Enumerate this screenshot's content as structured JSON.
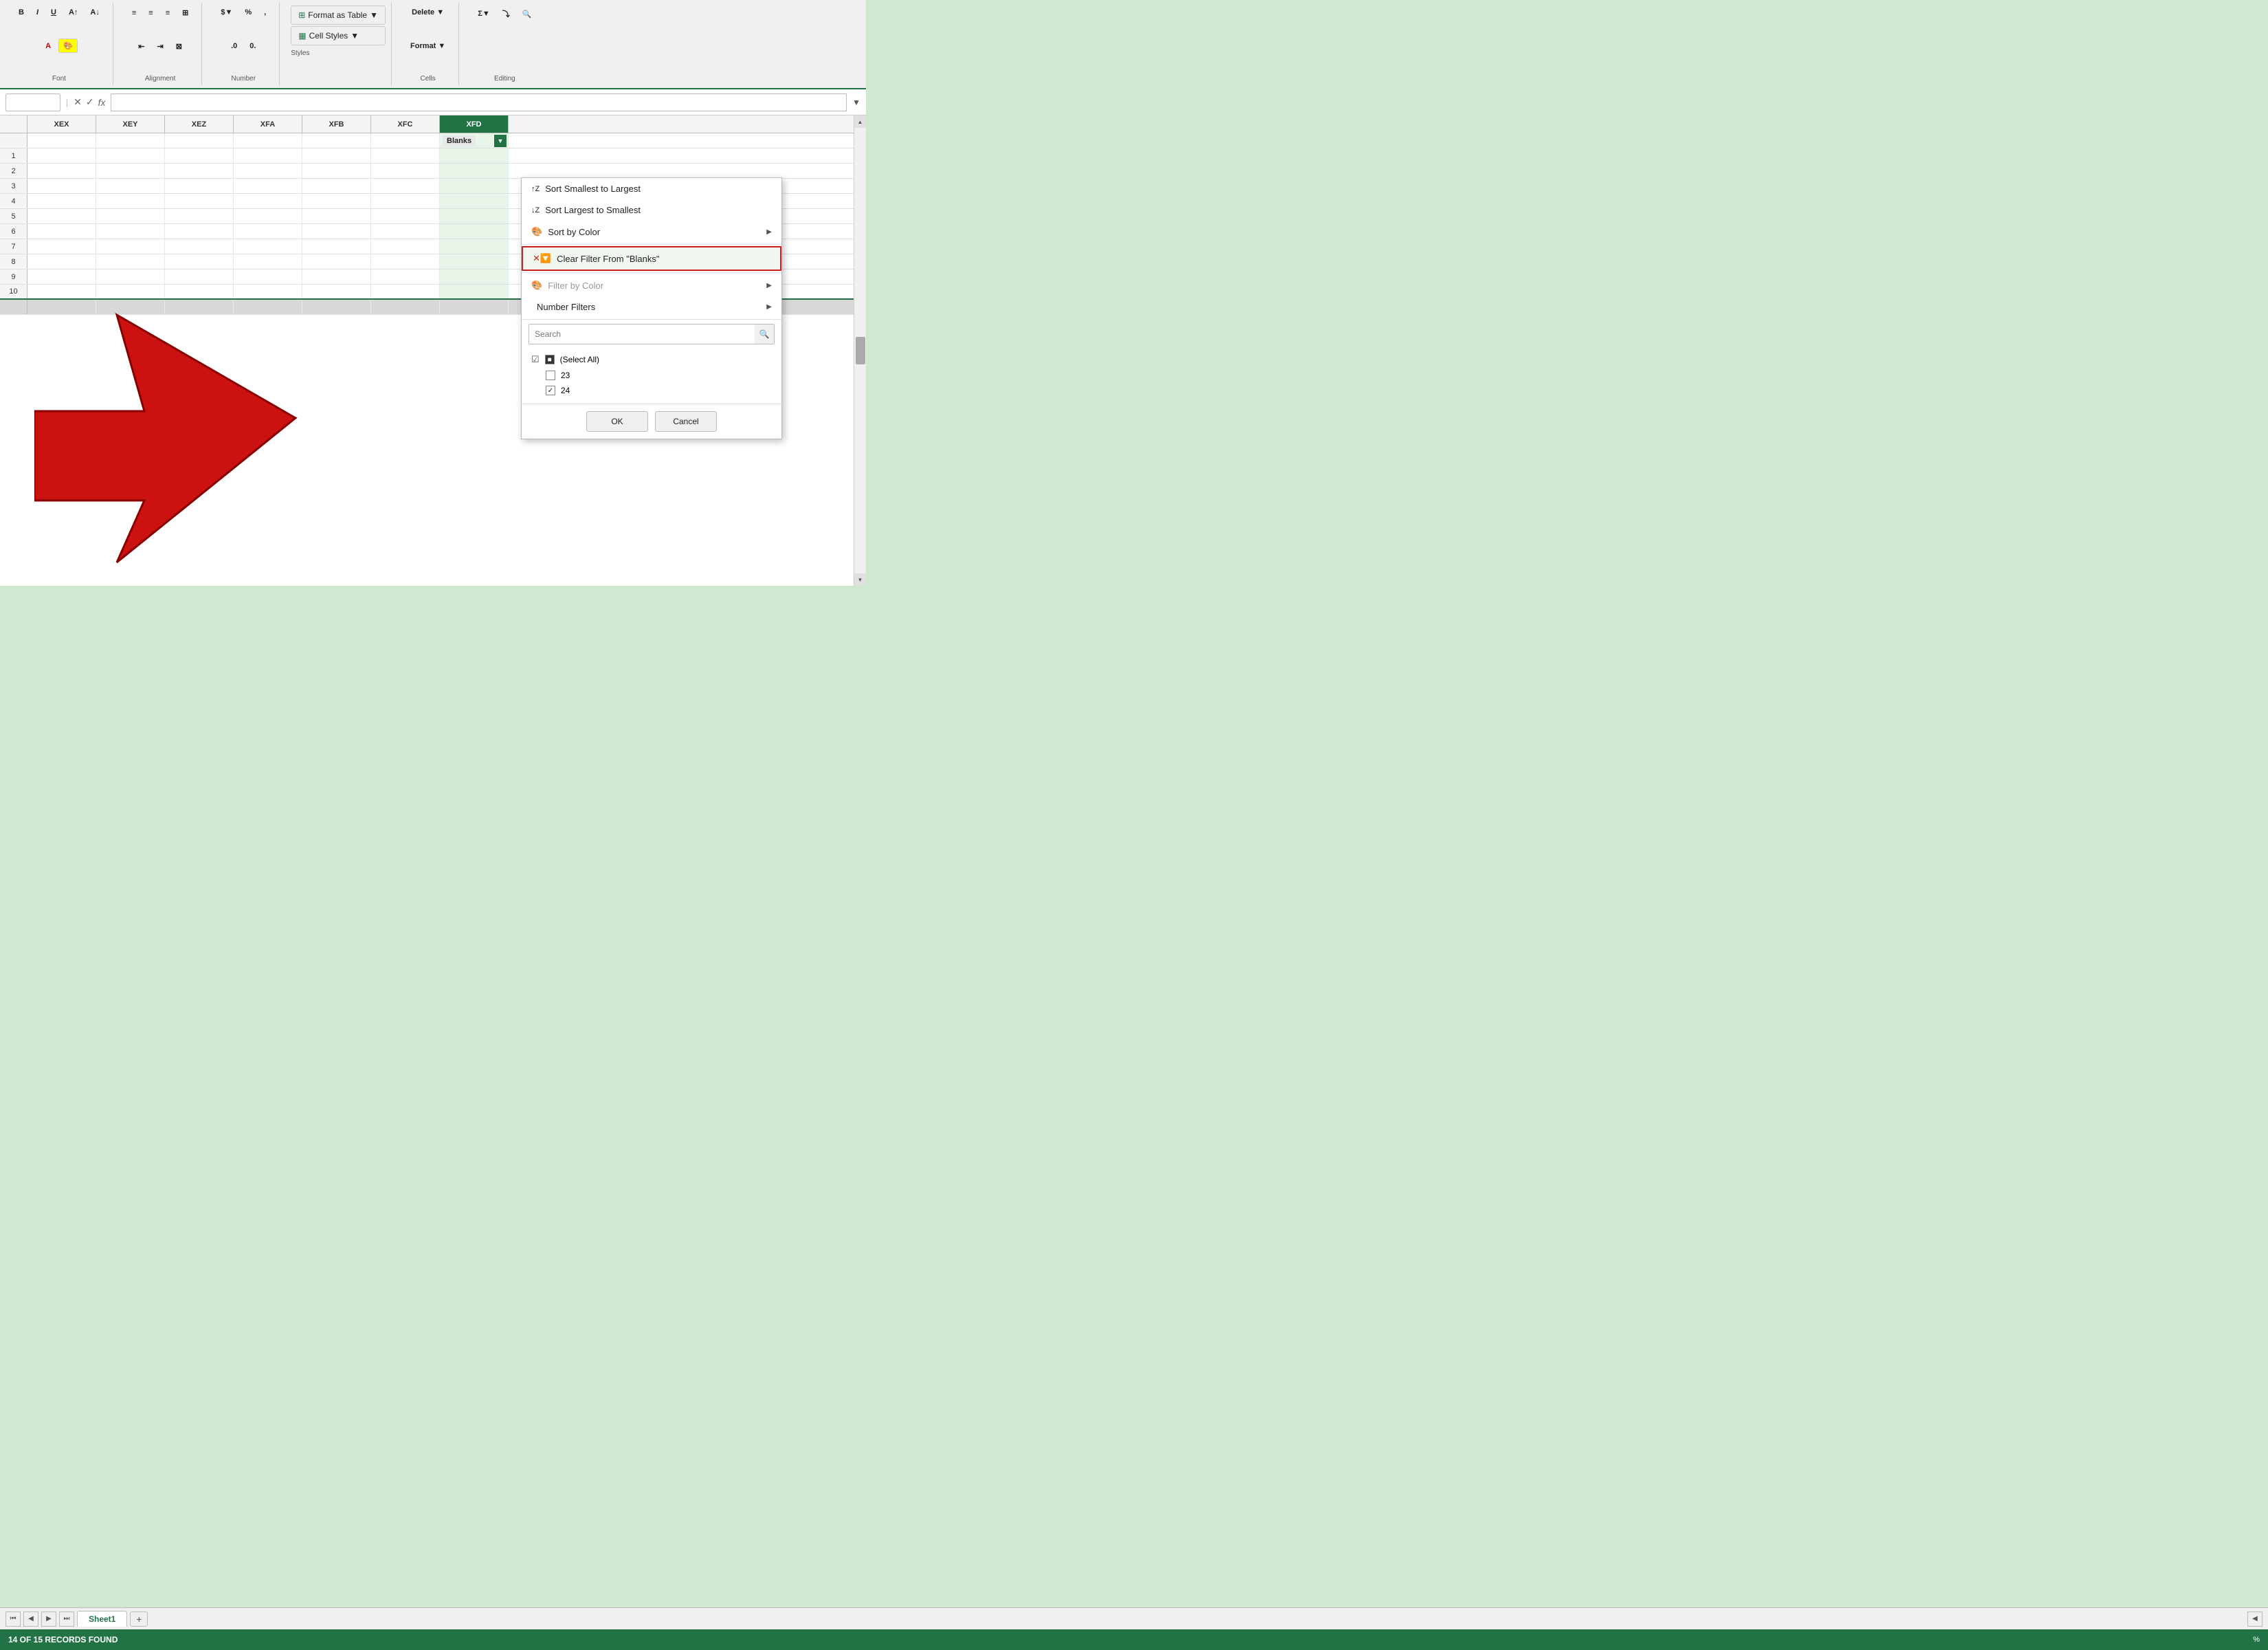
{
  "ribbon": {
    "sections": [
      {
        "label": "Font",
        "buttons": [
          "B",
          "I",
          "U",
          "A↑",
          "A↓"
        ]
      },
      {
        "label": "Alignment",
        "buttons": [
          "≡",
          "≡",
          "≡",
          "⊞"
        ]
      },
      {
        "label": "Number",
        "buttons": [
          "$",
          "%",
          ","
        ]
      },
      {
        "label": "Styles",
        "buttons": [
          "Format as Table ▼",
          "Cell Styles ▼"
        ]
      },
      {
        "label": "Cells",
        "buttons": [
          "Delete ▼",
          "Format ▼"
        ]
      },
      {
        "label": "Editing",
        "buttons": [
          "⌃",
          "🔍"
        ]
      }
    ],
    "format_as_table": "Format as Table",
    "cell_styles": "Cell Styles",
    "delete_btn": "Delete",
    "format_btn": "Format",
    "expand_icon": "▼"
  },
  "formula_bar": {
    "name_placeholder": "",
    "fx_symbol": "fx",
    "cancel_symbol": "✕",
    "confirm_symbol": "✓"
  },
  "columns": [
    "XEX",
    "XEY",
    "XEZ",
    "XFA",
    "XFB",
    "XFC",
    "XFD"
  ],
  "filter_column": "XFD",
  "filter_label": "Blanks",
  "menu": {
    "sort_smallest": "Sort Smallest to Largest",
    "sort_largest": "Sort Largest to Smallest",
    "sort_by_color": "Sort by Color",
    "clear_filter": "Clear Filter From \"Blanks\"",
    "filter_by_color": "Filter by Color",
    "number_filters": "Number Filters",
    "search_placeholder": "Search",
    "select_all": "(Select All)",
    "items": [
      {
        "label": "23",
        "checked": false
      },
      {
        "label": "24",
        "checked": true
      }
    ],
    "ok_label": "OK",
    "cancel_label": "Cancel"
  },
  "status_bar": {
    "text": "14 OF 15 RECORDS FOUND"
  },
  "sheet_tab": "Sheet1",
  "checkmark_full": "■",
  "checkmark_checked": "✓",
  "checkmark_unchecked": " "
}
